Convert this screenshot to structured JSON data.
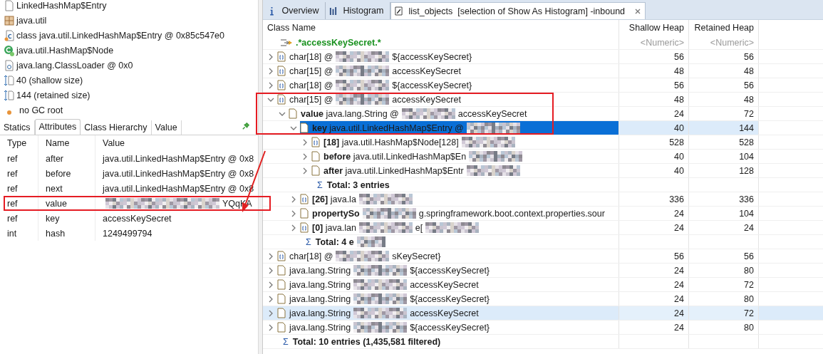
{
  "object_info": [
    {
      "kind": "entry",
      "text": "LinkedHashMap$Entry"
    },
    {
      "kind": "package",
      "text": "java.util"
    },
    {
      "kind": "class",
      "text": "class java.util.LinkedHashMap$Entry @ 0x85c547e0"
    },
    {
      "kind": "superclass",
      "text": "java.util.HashMap$Node"
    },
    {
      "kind": "loader",
      "text": "java.lang.ClassLoader @ 0x0"
    },
    {
      "kind": "size",
      "text": "40 (shallow size)"
    },
    {
      "kind": "size",
      "text": "144 (retained size)"
    },
    {
      "kind": "gcroot",
      "text": "no GC root"
    }
  ],
  "inspector_tabs": [
    {
      "label": "Statics",
      "selected": false
    },
    {
      "label": "Attributes",
      "selected": true
    },
    {
      "label": "Class Hierarchy",
      "selected": false
    },
    {
      "label": "Value",
      "selected": false
    }
  ],
  "attributes": {
    "columns": [
      "Type",
      "Name",
      "Value"
    ],
    "rows": [
      {
        "type": "ref",
        "name": "after",
        "value": [
          {
            "kind": "text",
            "text": "java.util.LinkedHashMap$Entry @ 0x8"
          }
        ],
        "boxed": false
      },
      {
        "type": "ref",
        "name": "before",
        "value": [
          {
            "kind": "text",
            "text": "java.util.LinkedHashMap$Entry @ 0x8"
          }
        ],
        "boxed": false
      },
      {
        "type": "ref",
        "name": "next",
        "value": [
          {
            "kind": "text",
            "text": "java.util.LinkedHashMap$Entry @ 0x8"
          }
        ],
        "boxed": false
      },
      {
        "type": "ref",
        "name": "value",
        "value": [
          {
            "kind": "redacted"
          },
          {
            "kind": "text",
            "text": "YQqKA"
          }
        ],
        "boxed": true
      },
      {
        "type": "ref",
        "name": "key",
        "value": [
          {
            "kind": "text",
            "text": "accessKeySecret"
          }
        ],
        "boxed": false
      },
      {
        "type": "int",
        "name": "hash",
        "value": [
          {
            "kind": "text",
            "text": "1249499794"
          }
        ],
        "boxed": false
      }
    ]
  },
  "editor_tabs": [
    {
      "label": "Overview",
      "selected": false
    },
    {
      "label": "Histogram",
      "selected": false
    },
    {
      "label": "list_objects  [selection of Show As Histogram] -inbound",
      "selected": true
    }
  ],
  "table": {
    "columns": [
      "Class Name",
      "Shallow Heap",
      "Retained Heap"
    ],
    "filter": {
      "name": ".*accessKeySecret.*",
      "shallow": "<Numeric>",
      "retained": "<Numeric>"
    },
    "rows": [
      {
        "kind": "array",
        "expanded": false,
        "selected": false,
        "hovered": false,
        "boxed": false,
        "name": [
          {
            "kind": "text",
            "text": "char[18] @"
          },
          {
            "kind": "redacted"
          },
          {
            "kind": "text",
            "text": "${accessKeySecret}"
          }
        ],
        "shallow": "56",
        "retained": "56"
      },
      {
        "kind": "array",
        "expanded": false,
        "selected": false,
        "hovered": false,
        "boxed": false,
        "name": [
          {
            "kind": "text",
            "text": "char[15] @"
          },
          {
            "kind": "redacted"
          },
          {
            "kind": "text",
            "text": "accessKeySecret"
          }
        ],
        "shallow": "48",
        "retained": "48"
      },
      {
        "kind": "array",
        "expanded": false,
        "selected": false,
        "hovered": false,
        "boxed": false,
        "name": [
          {
            "kind": "text",
            "text": "char[18] @"
          },
          {
            "kind": "redacted"
          },
          {
            "kind": "text",
            "text": "${accessKeySecret}"
          }
        ],
        "shallow": "56",
        "retained": "56"
      },
      {
        "kind": "array",
        "expanded": true,
        "selected": false,
        "hovered": false,
        "boxed": true,
        "name": [
          {
            "kind": "text",
            "text": "char[15] @"
          },
          {
            "kind": "redacted"
          },
          {
            "kind": "text",
            "text": "accessKeySecret"
          }
        ],
        "shallow": "48",
        "retained": "48",
        "children": [
          {
            "kind": "object",
            "expanded": true,
            "selected": false,
            "hovered": false,
            "boxed": true,
            "name": [
              {
                "kind": "text",
                "text": "**value** java.lang.String @"
              },
              {
                "kind": "redacted"
              },
              {
                "kind": "text",
                "text": "accessKeySecret"
              }
            ],
            "shallow": "24",
            "retained": "72",
            "children": [
              {
                "kind": "object",
                "expanded": true,
                "selected": true,
                "hovered": false,
                "boxed": true,
                "name": [
                  {
                    "kind": "text",
                    "text": "**key** java.util.LinkedHashMap$Entry @"
                  },
                  {
                    "kind": "redacted"
                  }
                ],
                "shallow": "40",
                "retained": "144",
                "children": [
                  {
                    "kind": "array",
                    "expanded": false,
                    "selected": false,
                    "hovered": false,
                    "boxed": false,
                    "name": [
                      {
                        "kind": "text",
                        "text": "**[18]** java.util.HashMap$Node[128]"
                      },
                      {
                        "kind": "redacted"
                      }
                    ],
                    "shallow": "528",
                    "retained": "528"
                  },
                  {
                    "kind": "object",
                    "expanded": false,
                    "selected": false,
                    "hovered": false,
                    "boxed": false,
                    "name": [
                      {
                        "kind": "text",
                        "text": "**before** java.util.LinkedHashMap$En"
                      },
                      {
                        "kind": "redacted"
                      }
                    ],
                    "shallow": "40",
                    "retained": "104"
                  },
                  {
                    "kind": "object",
                    "expanded": false,
                    "selected": false,
                    "hovered": false,
                    "boxed": false,
                    "name": [
                      {
                        "kind": "text",
                        "text": "**after** java.util.LinkedHashMap$Entr"
                      },
                      {
                        "kind": "redacted"
                      }
                    ],
                    "shallow": "40",
                    "retained": "128"
                  },
                  {
                    "kind": "total",
                    "symbol": "Σ",
                    "name": [
                      {
                        "kind": "text",
                        "text": "Total: 3 entries"
                      }
                    ]
                  }
                ]
              },
              {
                "kind": "array",
                "expanded": false,
                "selected": false,
                "hovered": false,
                "boxed": false,
                "name": [
                  {
                    "kind": "text",
                    "text": "**[26]** java.la"
                  },
                  {
                    "kind": "redacted"
                  }
                ],
                "shallow": "336",
                "retained": "336"
              },
              {
                "kind": "object",
                "expanded": false,
                "selected": false,
                "hovered": false,
                "boxed": false,
                "name": [
                  {
                    "kind": "text",
                    "text": "**propertySo**"
                  },
                  {
                    "kind": "redacted"
                  },
                  {
                    "kind": "text",
                    "text": "g.springframework.boot.context.properties.sour"
                  }
                ],
                "shallow": "24",
                "retained": "104"
              },
              {
                "kind": "array",
                "expanded": false,
                "selected": false,
                "hovered": false,
                "boxed": false,
                "name": [
                  {
                    "kind": "text",
                    "text": "**[0]** java.lan"
                  },
                  {
                    "kind": "redacted"
                  },
                  {
                    "kind": "text",
                    "text": "e["
                  },
                  {
                    "kind": "redacted"
                  }
                ],
                "shallow": "24",
                "retained": "24"
              },
              {
                "kind": "total",
                "symbol": "Σ",
                "name": [
                  {
                    "kind": "text",
                    "text": "Total: 4 e"
                  },
                  {
                    "kind": "redacted"
                  }
                ]
              }
            ]
          }
        ]
      },
      {
        "kind": "array",
        "expanded": false,
        "selected": false,
        "hovered": false,
        "boxed": false,
        "name": [
          {
            "kind": "text",
            "text": "char[18] @"
          },
          {
            "kind": "redacted"
          },
          {
            "kind": "text",
            "text": "sKeySecret}"
          }
        ],
        "shallow": "56",
        "retained": "56"
      },
      {
        "kind": "object",
        "expanded": false,
        "selected": false,
        "hovered": false,
        "boxed": false,
        "name": [
          {
            "kind": "text",
            "text": "java.lang.String"
          },
          {
            "kind": "redacted"
          },
          {
            "kind": "text",
            "text": "${accessKeySecret}"
          }
        ],
        "shallow": "24",
        "retained": "80"
      },
      {
        "kind": "object",
        "expanded": false,
        "selected": false,
        "hovered": false,
        "boxed": false,
        "name": [
          {
            "kind": "text",
            "text": "java.lang.String"
          },
          {
            "kind": "redacted"
          },
          {
            "kind": "text",
            "text": "accessKeySecret"
          }
        ],
        "shallow": "24",
        "retained": "72"
      },
      {
        "kind": "object",
        "expanded": false,
        "selected": false,
        "hovered": false,
        "boxed": false,
        "name": [
          {
            "kind": "text",
            "text": "java.lang.String"
          },
          {
            "kind": "redacted"
          },
          {
            "kind": "text",
            "text": "${accessKeySecret}"
          }
        ],
        "shallow": "24",
        "retained": "80"
      },
      {
        "kind": "object",
        "expanded": false,
        "selected": false,
        "hovered": true,
        "boxed": false,
        "name": [
          {
            "kind": "text",
            "text": "java.lang.String"
          },
          {
            "kind": "redacted"
          },
          {
            "kind": "text",
            "text": "accessKeySecret"
          }
        ],
        "shallow": "24",
        "retained": "72"
      },
      {
        "kind": "object",
        "expanded": false,
        "selected": false,
        "hovered": false,
        "boxed": false,
        "name": [
          {
            "kind": "text",
            "text": "java.lang.String"
          },
          {
            "kind": "redacted"
          },
          {
            "kind": "text",
            "text": "${accessKeySecret}"
          }
        ],
        "shallow": "24",
        "retained": "80"
      },
      {
        "kind": "total",
        "symbol": "Σ",
        "name": [
          {
            "kind": "text",
            "text": "Total: 10 entries (1,435,581 filtered)"
          }
        ]
      }
    ]
  }
}
